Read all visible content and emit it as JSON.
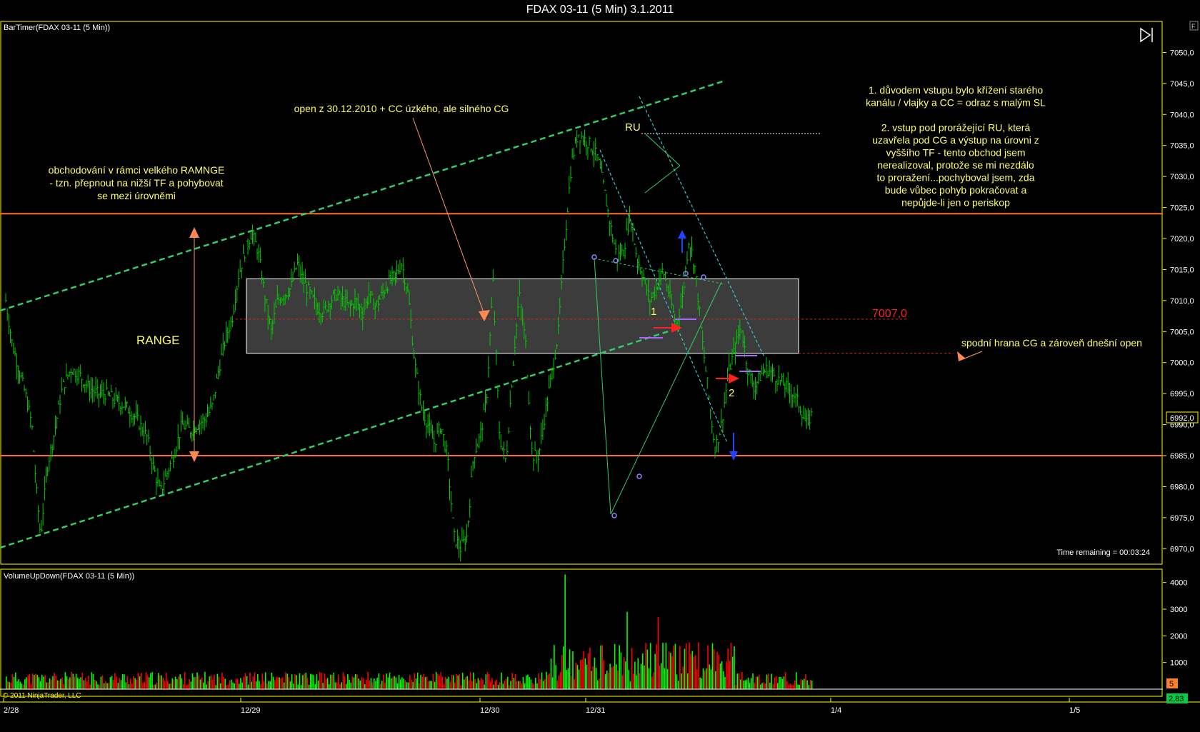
{
  "window": {
    "title": "FDAX 03-11 (5 Min)  3.1.2011",
    "copyright": "© 2011 NinjaTrader, LLC",
    "f_button": "F"
  },
  "price_panel": {
    "indicator_label": "BarTimer(FDAX 03-11 (5 Min))",
    "time_remaining": "Time remaining = 00:03:24",
    "current_price_tag": "6992,0"
  },
  "volume_panel": {
    "indicator_label": "VolumeUpDown(FDAX 03-11 (5 Min))",
    "current_value_tag": "5",
    "bottom_tag": "2,83"
  },
  "annotations": {
    "range_text": "RANGE",
    "range_note": [
      "obchodování v rámci velkého RAMNGE",
      "- tzn. přepnout na nižší TF a pohybovat",
      "se mezi úrovněmi"
    ],
    "open_note": "open z 30.12.2010 + CC úzkého, ale silného CG",
    "ru_label": "RU",
    "level_label": "7007,0",
    "marker_1": "1",
    "marker_2": "2",
    "bottom_edge_note": "spodní hrana CG  a zároveň dnešní open",
    "right_note": [
      "1.  důvodem vstupu bylo křížení starého",
      "kanálu / vlajky a CC = odraz s malým SL",
      "",
      "2. vstup pod prorážející RU, která",
      "uzavřela pod CG a výstup na úrovni z",
      "vyššího TF - tento obchod jsem",
      "nerealizoval, protože se mi nezdálo",
      "to proražení...pochyboval jsem, zda",
      "bude vůbec pohyb pokračovat a",
      "nepůjde-li jen o periskop"
    ]
  },
  "colors": {
    "axis": "#ffff00",
    "up_bar": "#00cc00",
    "volume_up": "#00ff00",
    "volume_down": "#ff0000",
    "level_line": "#ff6a3a",
    "channel": "#33cc66",
    "cyan": "#33cccc",
    "box": "#ffffff",
    "text_yellow": "#ffff66"
  },
  "chart_data": [
    {
      "type": "candlestick",
      "name": "price",
      "ylim": [
        6967.5,
        7055
      ],
      "yticks": [
        "7050,0",
        "7045,0",
        "7040,0",
        "7035,0",
        "7030,0",
        "7025,0",
        "7020,0",
        "7015,0",
        "7010,0",
        "7005,0",
        "7000,0",
        "6995,0",
        "6990,0",
        "6985,0",
        "6980,0",
        "6975,0",
        "6970,0"
      ],
      "xticks": [
        "2/28",
        "12/29",
        "12/30",
        "12/31",
        "1/4",
        "1/5"
      ],
      "levels": [
        7024.0,
        6985.0,
        7007.0
      ],
      "cg_box": [
        7001.5,
        7013.5
      ],
      "series_path": [
        [
          0,
          7010
        ],
        [
          3,
          7003
        ],
        [
          6,
          6999
        ],
        [
          9,
          6995
        ],
        [
          12,
          6990
        ],
        [
          14,
          6980
        ],
        [
          16,
          6972
        ],
        [
          19,
          6983
        ],
        [
          22,
          6988
        ],
        [
          26,
          6996
        ],
        [
          30,
          6999
        ],
        [
          34,
          6998
        ],
        [
          38,
          6996
        ],
        [
          42,
          6995
        ],
        [
          46,
          6995
        ],
        [
          50,
          6994
        ],
        [
          55,
          6993
        ],
        [
          60,
          6991
        ],
        [
          65,
          6988
        ],
        [
          68,
          6983
        ],
        [
          71,
          6979
        ],
        [
          74,
          6982
        ],
        [
          78,
          6986
        ],
        [
          81,
          6990
        ],
        [
          85,
          6989
        ],
        [
          88,
          6990
        ],
        [
          92,
          6991
        ],
        [
          95,
          6993
        ],
        [
          98,
          6999
        ],
        [
          101,
          7004
        ],
        [
          104,
          7007
        ],
        [
          107,
          7014
        ],
        [
          110,
          7018
        ],
        [
          113,
          7021
        ],
        [
          116,
          7018
        ],
        [
          119,
          7011
        ],
        [
          122,
          7005
        ],
        [
          125,
          7010
        ],
        [
          128,
          7011
        ],
        [
          131,
          7012
        ],
        [
          134,
          7016
        ],
        [
          137,
          7013
        ],
        [
          140,
          7011
        ],
        [
          143,
          7009
        ],
        [
          146,
          7008
        ],
        [
          149,
          7010
        ],
        [
          152,
          7011
        ],
        [
          155,
          7010
        ],
        [
          158,
          7009
        ],
        [
          161,
          7010
        ],
        [
          164,
          7008
        ],
        [
          167,
          7011
        ],
        [
          170,
          7009
        ],
        [
          173,
          7011
        ],
        [
          176,
          7013
        ],
        [
          179,
          7014
        ],
        [
          182,
          7016
        ],
        [
          185,
          7011
        ],
        [
          188,
          7000
        ],
        [
          191,
          6993
        ],
        [
          194,
          6990
        ],
        [
          197,
          6987
        ],
        [
          200,
          6990
        ],
        [
          203,
          6985
        ],
        [
          206,
          6972
        ],
        [
          209,
          6970
        ],
        [
          212,
          6972
        ],
        [
          215,
          6985
        ],
        [
          218,
          6988
        ],
        [
          221,
          6994
        ],
        [
          224,
          7013
        ],
        [
          227,
          6988
        ],
        [
          230,
          6984
        ],
        [
          233,
          6999
        ],
        [
          236,
          7011
        ],
        [
          239,
          7003
        ],
        [
          242,
          6985
        ],
        [
          245,
          6985
        ],
        [
          248,
          6992
        ],
        [
          251,
          6998
        ],
        [
          254,
          7005
        ],
        [
          257,
          7020
        ],
        [
          260,
          7032
        ],
        [
          263,
          7037
        ],
        [
          266,
          7036
        ],
        [
          269,
          7035
        ],
        [
          272,
          7033
        ],
        [
          275,
          7028
        ],
        [
          278,
          7022
        ],
        [
          281,
          7017
        ],
        [
          284,
          7018
        ],
        [
          287,
          7024
        ],
        [
          290,
          7017
        ],
        [
          293,
          7014
        ],
        [
          296,
          7010
        ],
        [
          299,
          7012
        ],
        [
          302,
          7015
        ],
        [
          305,
          7011
        ],
        [
          308,
          7006
        ],
        [
          311,
          7010
        ],
        [
          314,
          7020
        ],
        [
          317,
          7015
        ],
        [
          320,
          7004
        ],
        [
          323,
          6995
        ],
        [
          326,
          6986
        ],
        [
          329,
          6990
        ],
        [
          332,
          6998
        ],
        [
          335,
          7002
        ],
        [
          338,
          7006
        ],
        [
          341,
          6999
        ],
        [
          344,
          6996
        ],
        [
          347,
          6998
        ],
        [
          350,
          6999
        ],
        [
          353,
          6998
        ],
        [
          356,
          6997
        ],
        [
          359,
          6996
        ],
        [
          362,
          6995
        ],
        [
          365,
          6993
        ],
        [
          368,
          6990
        ],
        [
          371,
          6992
        ]
      ],
      "series_path_x_domain": [
        0,
        520
      ]
    },
    {
      "type": "bar",
      "name": "volume",
      "ylim": [
        0,
        4500
      ],
      "yticks": [
        "4000",
        "3000",
        "2000",
        "1000"
      ]
    }
  ]
}
